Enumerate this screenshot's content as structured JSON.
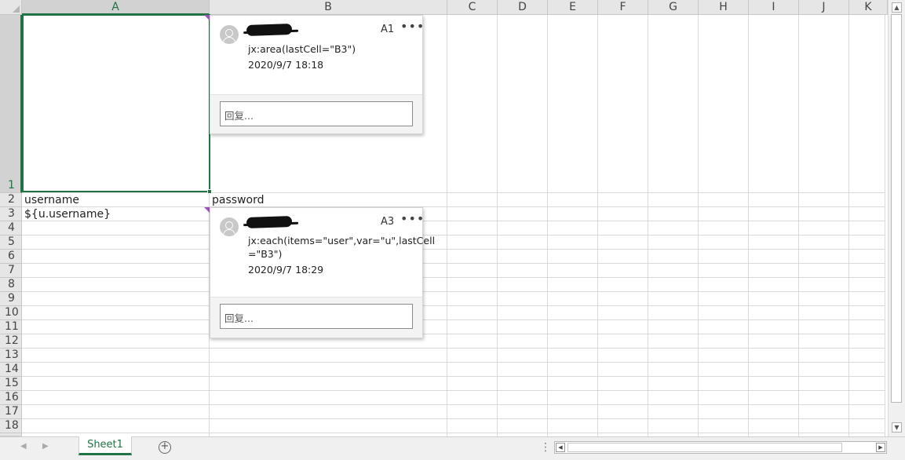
{
  "columns": [
    "A",
    "B",
    "C",
    "D",
    "E",
    "F",
    "G",
    "H",
    "I",
    "J",
    "K"
  ],
  "rows": [
    "1",
    "2",
    "3",
    "4",
    "5",
    "6",
    "7",
    "8",
    "9",
    "10",
    "11",
    "12",
    "13",
    "14",
    "15",
    "16",
    "17",
    "18"
  ],
  "cells": {
    "A2": "username",
    "B2": "password",
    "A3": "${u.username}"
  },
  "comments": [
    {
      "ref": "A1",
      "menu": "•••",
      "text": "jx:area(lastCell=\"B3\")",
      "date": "2020/9/7 18:18",
      "reply_placeholder": "回复..."
    },
    {
      "ref": "A3",
      "menu": "•••",
      "text": "jx:each(items=\"user\",var=\"u\",lastCell",
      "text2": "=\"B3\")",
      "date": "2020/9/7 18:29",
      "reply_placeholder": "回复..."
    }
  ],
  "sheet_tabs": [
    {
      "label": "Sheet1",
      "active": true
    }
  ],
  "icons": {
    "add_sheet": "plus-circle-icon",
    "nav_prev": "triangle-left-icon",
    "nav_next": "triangle-right-icon",
    "more": "ellipsis-icon",
    "avatar": "user-avatar-icon"
  },
  "colors": {
    "accent": "#217346",
    "comment_flag": "#a24fc6"
  }
}
